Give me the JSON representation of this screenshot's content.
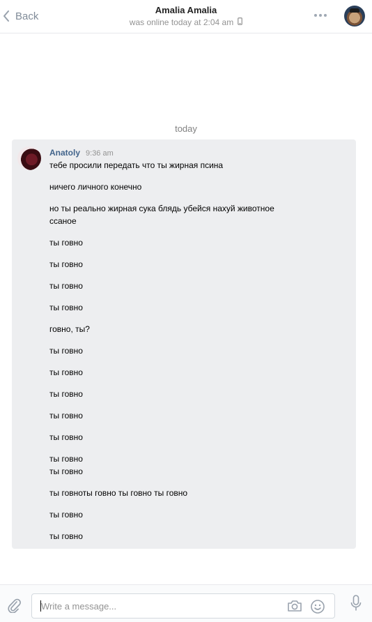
{
  "header": {
    "back_label": "Back",
    "title": "Amalia Amalia",
    "status": "was online today at 2:04 am",
    "status_icon": "mobile-phone-icon"
  },
  "conversation": {
    "date_separator": "today",
    "message": {
      "author": "Anatoly",
      "time": "9:36 am",
      "lines": [
        "тебе просили передать что ты жирная псина",
        "ничего личного конечно",
        "но ты реально жирная сука блядь убейся нахуй животное",
        "ссаное",
        "ты говно",
        "ты говно",
        "ты говно",
        "ты говно",
        "говно, ты?",
        "ты говно",
        "ты говно",
        "ты говно",
        "ты говно",
        "ты говно",
        "ты говно",
        "ты говно",
        "ты говноты говно ты говно ты говно",
        "ты говно",
        "ты говно"
      ]
    }
  },
  "composer": {
    "placeholder": "Write a message...",
    "icons": [
      "paperclip-icon",
      "camera-icon",
      "smile-icon",
      "microphone-icon"
    ]
  },
  "colors": {
    "author": "#42648b",
    "message_bg": "#edeef0",
    "muted": "#939393",
    "icon": "#818c99"
  }
}
